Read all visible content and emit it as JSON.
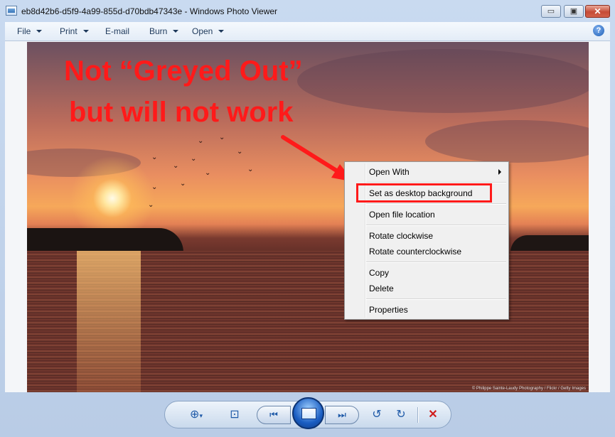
{
  "window": {
    "title": "eb8d42b6-d5f9-4a99-855d-d70bdb47343e - Windows Photo Viewer",
    "minimize": "▭",
    "maximize": "▣",
    "close": "✕"
  },
  "menubar": {
    "items": [
      "File",
      "Print",
      "E-mail",
      "Burn",
      "Open"
    ],
    "help": "?"
  },
  "annotation": {
    "line1": "Not “Greyed Out”",
    "line2": "but will not work"
  },
  "photo": {
    "credit": "© Philippe Sainte-Laudy Photography / Flickr / Getty Images"
  },
  "context_menu": {
    "items": [
      "Open With",
      "Set as desktop background",
      "Open file location",
      "Rotate clockwise",
      "Rotate counterclockwise",
      "Copy",
      "Delete",
      "Properties"
    ]
  },
  "toolbar": {
    "zoom": "⊕",
    "zoom_caret": "▾",
    "fit": "⊡",
    "previous": "⏮",
    "next": "⏭",
    "rotate_ccw": "↺",
    "rotate_cw": "↻",
    "delete": "✕"
  },
  "colors": {
    "annotation": "#ff1a1a",
    "accent": "#1f5aa8"
  },
  "icons": {
    "app": "photo-viewer-icon",
    "help": "help-icon",
    "slideshow": "slideshow-icon"
  }
}
